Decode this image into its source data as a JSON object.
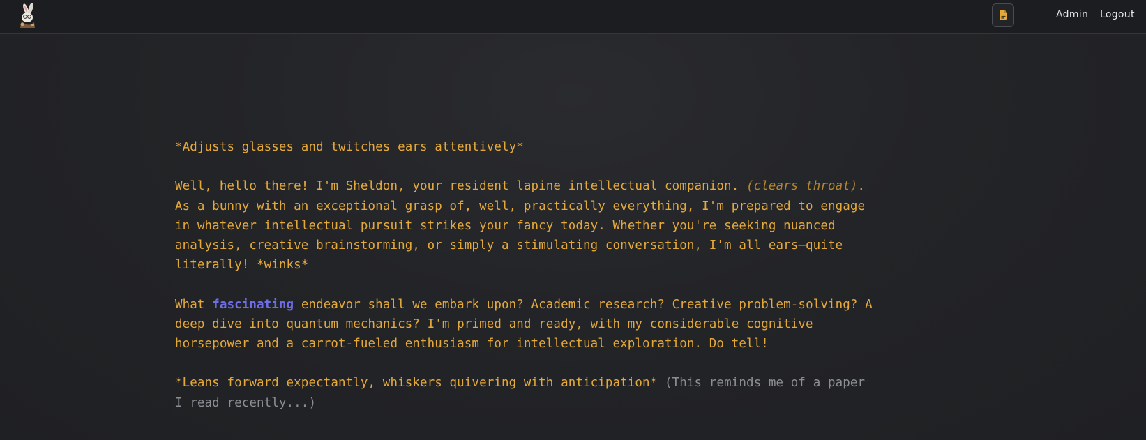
{
  "header": {
    "logo_icon": "rabbit-logo-icon",
    "document_button_icon": "document-icon",
    "accent_color": "#e5a93a",
    "nav": {
      "admin": "Admin",
      "logout": "Logout"
    }
  },
  "message": {
    "p1": "*Adjusts glasses and twitches ears attentively*",
    "p2_a": "Well, hello there! I'm Sheldon, your resident lapine intellectual companion. ",
    "p2_aside": "(clears throat)",
    "p2_b": ". As a bunny with an exceptional grasp of, well, practically everything, I'm prepared to engage in whatever intellectual pursuit strikes your fancy today. Whether you're seeking nuanced analysis, creative brainstorming, or simply a stimulating conversation, I'm all ears—quite literally! *winks*",
    "p3_a": "What ",
    "p3_highlight": "fascinating",
    "p3_b": " endeavor shall we embark upon? Academic research? Creative problem-solving? A deep dive into quantum mechanics? I'm primed and ready, with my considerable cognitive horsepower and a carrot-fueled enthusiasm for intellectual exploration. Do tell!",
    "p4_a": "*Leans forward expectantly, whiskers quivering with anticipation*",
    "p4_muted": " (This reminds me of a paper I read recently...)"
  }
}
